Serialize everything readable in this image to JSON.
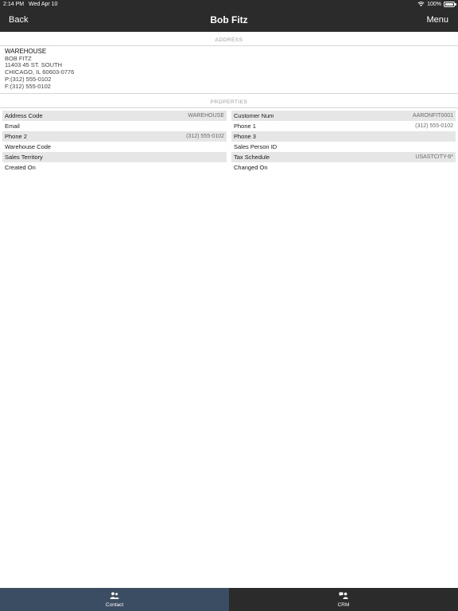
{
  "status_bar": {
    "time": "2:14 PM",
    "date": "Wed Apr 10",
    "battery": "100%"
  },
  "nav": {
    "back_label": "Back",
    "title": "Bob Fitz",
    "menu_label": "Menu"
  },
  "address_section": {
    "header": "ADDRESS",
    "name": "WAREHOUSE",
    "lines": [
      "BOB FITZ",
      "11403 45 ST. SOUTH",
      "CHICAGO, IL 60603-0776",
      "P:(312) 555-0102",
      "F:(312) 555-0102"
    ]
  },
  "properties_section": {
    "header": "PROPERTIES",
    "left": [
      {
        "label": "Address Code",
        "value": "WAREHOUSE"
      },
      {
        "label": "Email",
        "value": ""
      },
      {
        "label": "Phone 2",
        "value": "(312) 555-0102"
      },
      {
        "label": "Warehouse Code",
        "value": ""
      },
      {
        "label": "Sales Territory",
        "value": ""
      },
      {
        "label": "Created On",
        "value": ""
      }
    ],
    "right": [
      {
        "label": "Customer Num",
        "value": "AARONFIT0001"
      },
      {
        "label": "Phone 1",
        "value": "(312) 555-0102"
      },
      {
        "label": "Phone 3",
        "value": ""
      },
      {
        "label": "Sales Person ID",
        "value": ""
      },
      {
        "label": "Tax Schedule",
        "value": "USASTCITY-6*"
      },
      {
        "label": "Changed On",
        "value": ""
      }
    ]
  },
  "tabbar": {
    "tabs": [
      {
        "label": "Contact",
        "icon": "contact-icon",
        "active": true
      },
      {
        "label": "CRM",
        "icon": "crm-icon",
        "active": false
      }
    ]
  }
}
